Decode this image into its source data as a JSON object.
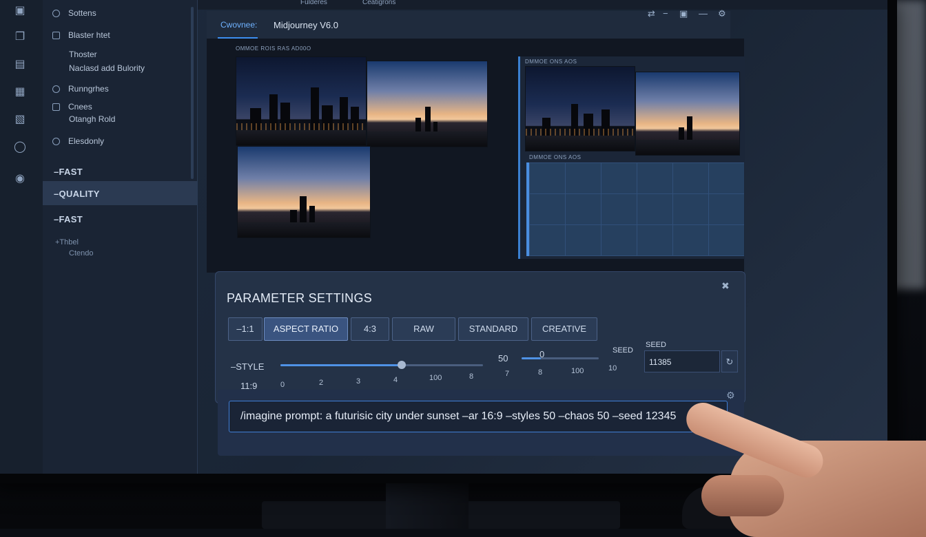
{
  "topbar": {
    "left_label": "Fulderes",
    "right_label": "Ceatigrons"
  },
  "rail": {
    "icons": [
      "app-icon",
      "copy-icon",
      "document-icon",
      "box-icon",
      "calendar-icon",
      "circle-icon",
      "account-icon"
    ]
  },
  "side": {
    "items": [
      {
        "label": "Sottens",
        "marker": "circle"
      },
      {
        "label": "Blaster htet",
        "marker": "square"
      },
      {
        "label": "Thoster",
        "marker": "none"
      },
      {
        "label": "Naclasd add Bulority",
        "marker": "none"
      },
      {
        "label": "Runngrhes",
        "marker": "circle"
      },
      {
        "label": "Cnees",
        "marker": "square"
      },
      {
        "label": "Otangh Rold",
        "marker": "none"
      },
      {
        "label": "Elesdonly",
        "marker": "circle"
      }
    ],
    "modes": [
      "–FAST",
      "–QUALITY",
      "–FAST"
    ],
    "active_mode_index": 1,
    "footer": [
      "+Thbel",
      "Ctendo"
    ]
  },
  "tabs": {
    "active": "Cwovnee:",
    "title": "Midjourney V6.0",
    "tools": [
      "swap-icon",
      "minus-icon",
      "save-icon",
      "minimize-icon",
      "gear-icon"
    ]
  },
  "grid": {
    "caption_left": "OMMOE ROIS RAS AD00O",
    "caption_right_top": "DMMOE ONS AOS",
    "caption_right_mid": "DMMOE ONS AOS"
  },
  "params": {
    "title": "PARAMETER SETTINGS",
    "buttons": [
      "–1:1",
      "ASPECT RATIO",
      "4:3",
      "RAW",
      "STANDARD",
      "CREATIVE"
    ],
    "active_button": "ASPECT RATIO",
    "style_label": "–STYLE",
    "style_value": "11:9",
    "style_ticks": [
      "0",
      "2",
      "3",
      "4",
      "100",
      "8"
    ],
    "style_slider_fraction": 0.6,
    "mid_value": "50",
    "mid_ticks": [
      "7",
      "8",
      "100",
      "10"
    ],
    "chaos_value": "0",
    "chaos_slider_fraction": 0.25,
    "seed_side_label": "SEED",
    "seed_label": "SEED",
    "seed_value": "11385"
  },
  "prompt": {
    "text": "/imagine prompt: a futurisic city under sunset –ar 16:9 –styles 50 –chaos 50 –seed 12345"
  },
  "colors": {
    "accent": "#3c8ef0",
    "panel": "#243247",
    "sidebar": "#1a2434"
  }
}
